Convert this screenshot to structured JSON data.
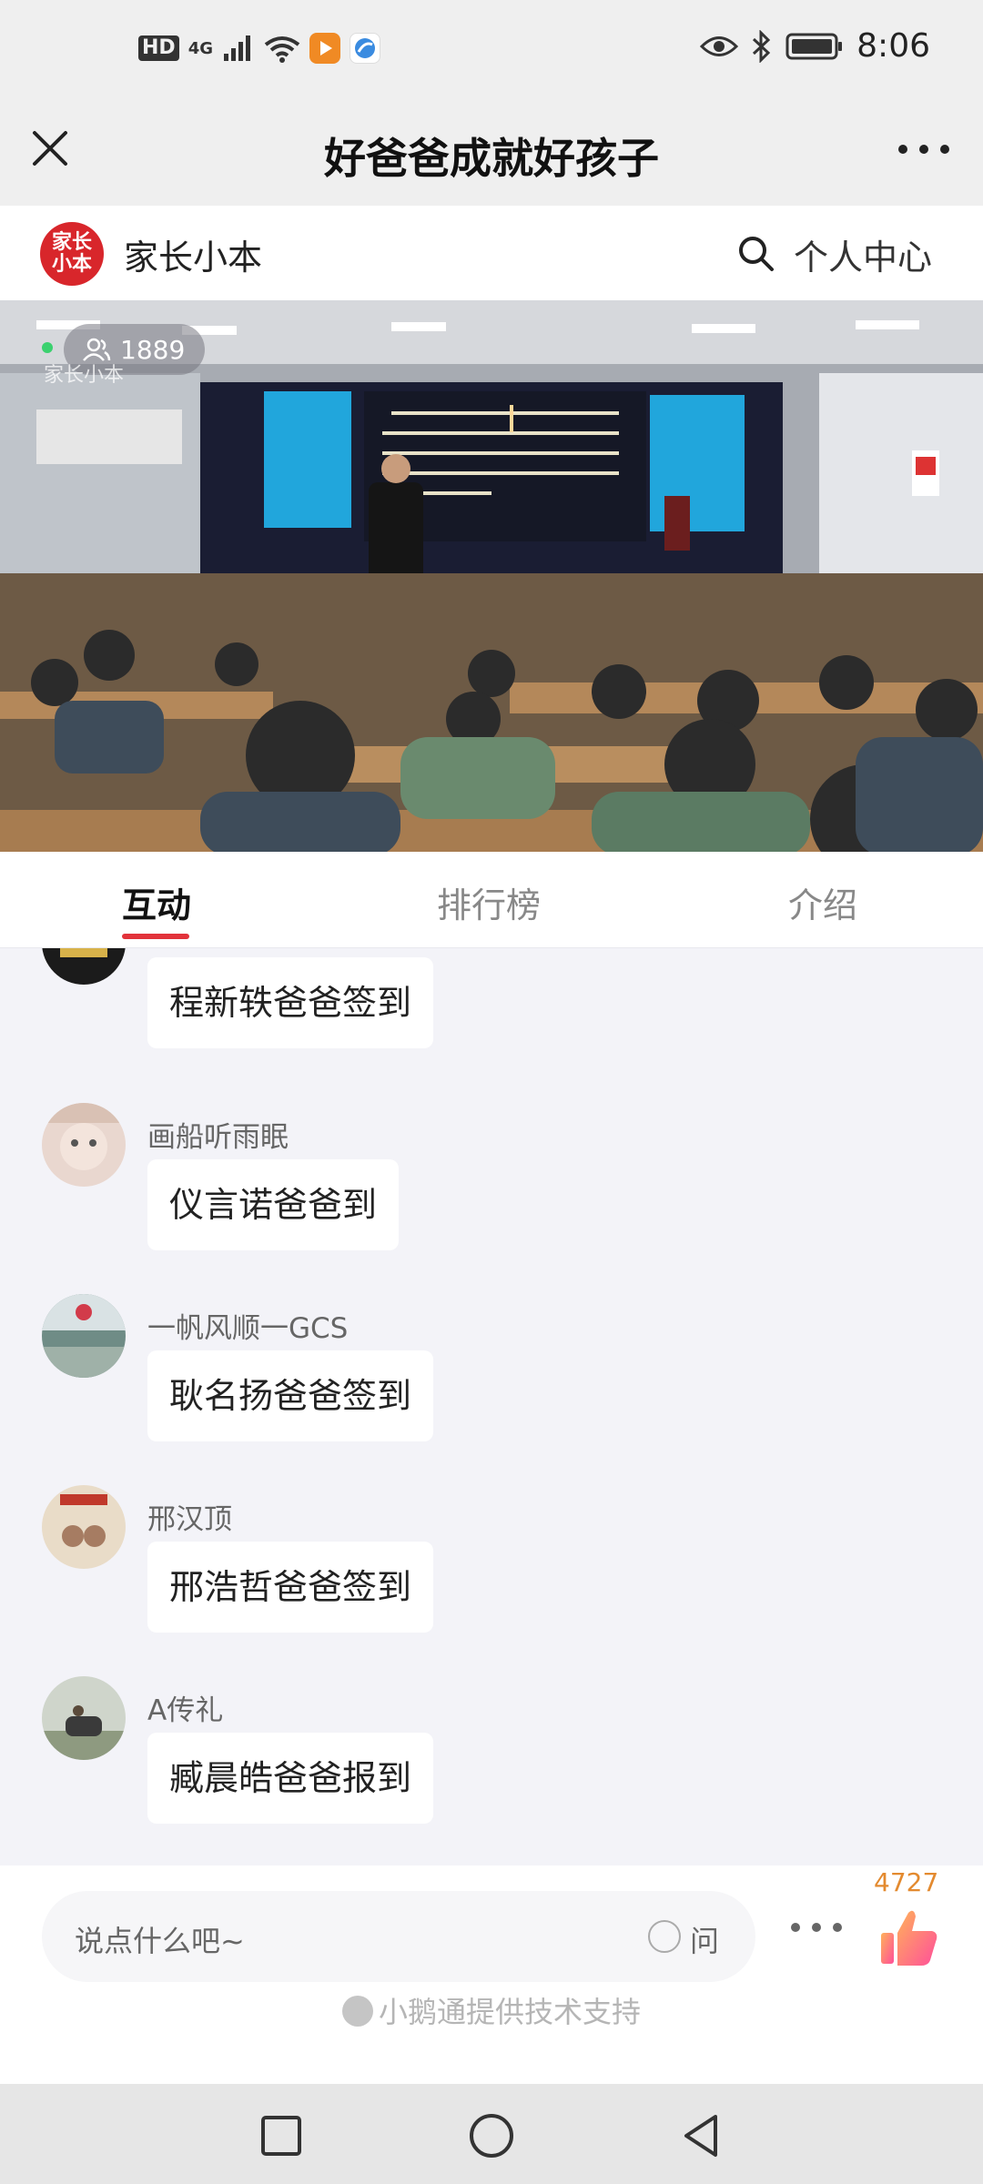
{
  "status_bar": {
    "hd_label": "HD",
    "network_label": "4G",
    "time": "8:06",
    "icons": [
      "signal-icon",
      "wifi-icon",
      "video-app-icon",
      "browser-app-icon",
      "eye-icon",
      "bluetooth-icon",
      "battery-icon"
    ]
  },
  "header": {
    "title": "好爸爸成就好孩子",
    "close_icon": "close-icon",
    "more_icon": "more-icon"
  },
  "brand": {
    "logo_text": "家长小本",
    "name": "家长小本",
    "center_label": "个人中心"
  },
  "video": {
    "viewer_count": "1889",
    "watermark": "家长小本"
  },
  "tabs": [
    {
      "label": "互动",
      "active": true
    },
    {
      "label": "排行榜",
      "active": false
    },
    {
      "label": "介绍",
      "active": false
    }
  ],
  "messages": [
    {
      "nickname": "",
      "text": "程新轶爸爸签到",
      "avatar_color": "#1b1b1b"
    },
    {
      "nickname": "画船听雨眠",
      "text": "仪言诺爸爸到",
      "avatar_color": "#e9d7cf"
    },
    {
      "nickname": "一帆风顺一GCS",
      "text": "耿名扬爸爸签到",
      "avatar_color": "#6f8c86"
    },
    {
      "nickname": "邢汉顶",
      "text": "邢浩哲爸爸签到",
      "avatar_color": "#c9b08f"
    },
    {
      "nickname": "A传礼",
      "text": "臧晨皓爸爸报到",
      "avatar_color": "#7b8a74"
    }
  ],
  "input": {
    "placeholder": "说点什么吧~",
    "ask_label": "问",
    "like_count": "4727"
  },
  "footer": {
    "powered_by": "小鹅通提供技术支持"
  },
  "colors": {
    "accent": "#e2323a",
    "like_count": "#e38a2f",
    "background": "#f3f3f8"
  }
}
